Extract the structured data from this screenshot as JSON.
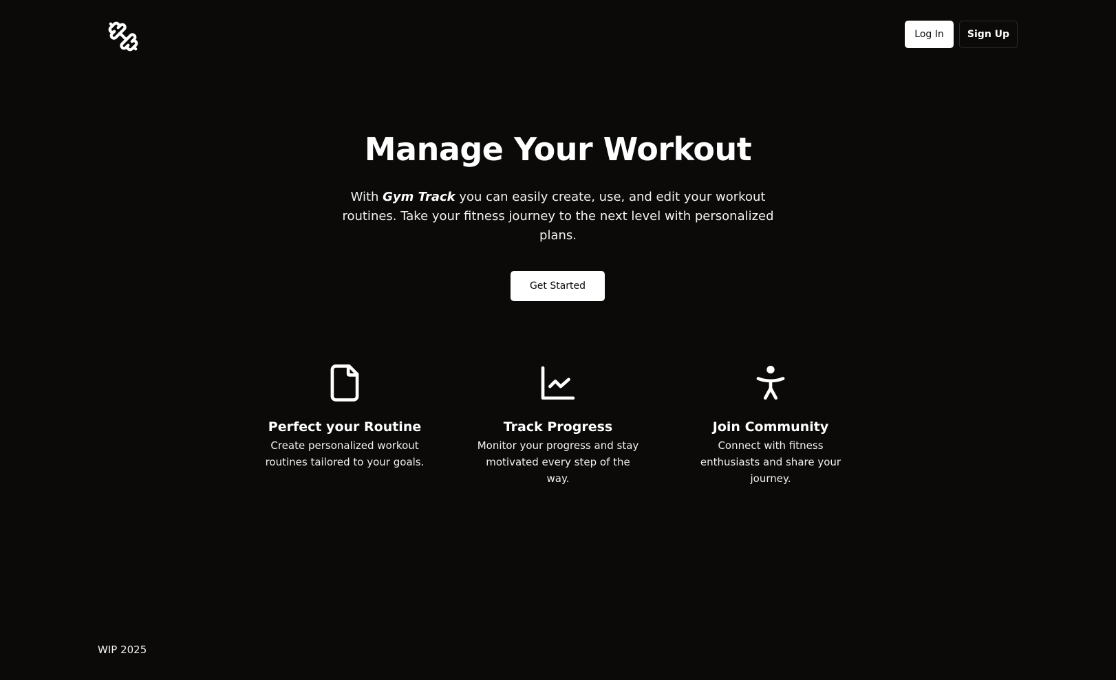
{
  "header": {
    "logo_icon": "dumbbell-icon",
    "login_label": "Log In",
    "signup_label": "Sign Up"
  },
  "hero": {
    "title": "Manage Your Workout",
    "subtitle_prefix": "With ",
    "brand": "Gym Track",
    "subtitle_suffix": " you can easily create, use, and edit your workout routines. Take your fitness journey to the next level with personalized plans.",
    "cta_label": "Get Started"
  },
  "features": [
    {
      "icon": "file-icon",
      "title": "Perfect your Routine",
      "description": "Create personalized workout routines tailored to your goals."
    },
    {
      "icon": "line-chart-icon",
      "title": "Track Progress",
      "description": "Monitor your progress and stay motivated every step of the way."
    },
    {
      "icon": "accessibility-icon",
      "title": "Join Community",
      "description": "Connect with fitness enthusiasts and share your journey."
    }
  ],
  "footer": {
    "text": "WIP 2025"
  },
  "colors": {
    "background": "#0b0a09",
    "foreground": "#ffffff",
    "button_border": "#2c2c2c"
  }
}
